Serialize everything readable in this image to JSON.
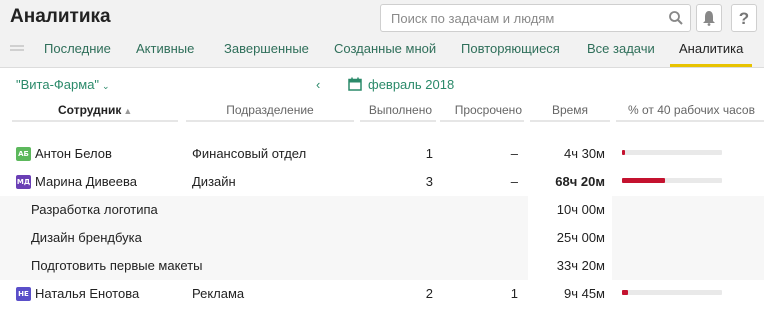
{
  "app": {
    "title": "Аналитика"
  },
  "search": {
    "placeholder": "Поиск по задачам и людям"
  },
  "tabs": [
    {
      "label": "Последние"
    },
    {
      "label": "Активные"
    },
    {
      "label": "Завершенные"
    },
    {
      "label": "Созданные мной"
    },
    {
      "label": "Повторяющиеся"
    },
    {
      "label": "Все задачи"
    },
    {
      "label": "Аналитика"
    }
  ],
  "active_tab": "Аналитика",
  "toolbar": {
    "project": "\"Вита-Фарма\"",
    "prev_label": "‹",
    "month": "февраль 2018"
  },
  "columns": {
    "employee": "Сотрудник",
    "department": "Подразделение",
    "done": "Выполнено",
    "overdue": "Просрочено",
    "time": "Время",
    "percent": "% от 40 рабочих часов"
  },
  "colors": {
    "accent": "#2b8a6a",
    "bar": "#c4122f",
    "tab_underline": "#e8c300"
  },
  "rows": [
    {
      "initials": "АБ",
      "avatar_color": "#5cb85c",
      "name": "Антон Белов",
      "department": "Финансовый отдел",
      "done": "1",
      "overdue": "–",
      "time": "4ч 30м",
      "percent": 2.8
    },
    {
      "initials": "МД",
      "avatar_color": "#6a3fb5",
      "name": "Марина Дивеева",
      "department": "Дизайн",
      "done": "3",
      "overdue": "–",
      "time": "68ч 20м",
      "percent": 42.7
    },
    {
      "task": "Разработка логотипа",
      "time": "10ч 00м"
    },
    {
      "task": "Дизайн брендбука",
      "time": "25ч 00м"
    },
    {
      "task": "Подготовить первые макеты",
      "time": "33ч 20м"
    },
    {
      "initials": "НЕ",
      "avatar_color": "#5a4fc9",
      "name": "Наталья Енотова",
      "department": "Реклама",
      "done": "2",
      "overdue": "1",
      "time": "9ч 45м",
      "percent": 6.1
    }
  ]
}
